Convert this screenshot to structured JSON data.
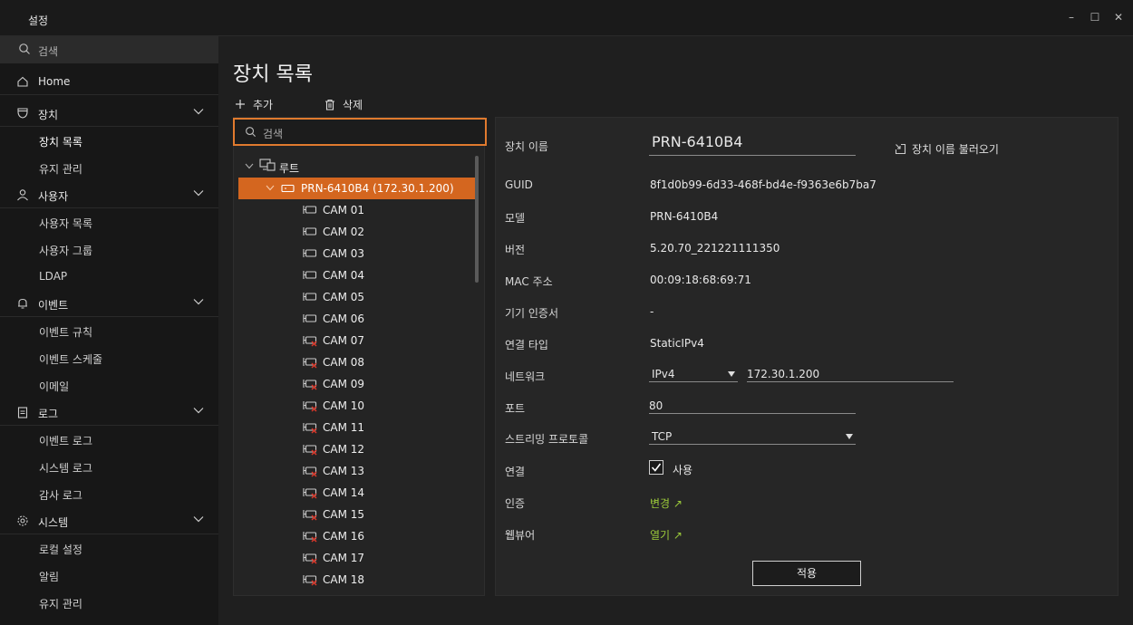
{
  "window": {
    "title": "설정"
  },
  "sidebar": {
    "search_placeholder": "검색",
    "home": "Home",
    "groups": [
      {
        "label": "장치",
        "items": [
          "장치 목록",
          "유지 관리"
        ]
      },
      {
        "label": "사용자",
        "items": [
          "사용자 목록",
          "사용자 그룹",
          "LDAP"
        ]
      },
      {
        "label": "이벤트",
        "items": [
          "이벤트 규칙",
          "이벤트 스케줄",
          "이메일"
        ]
      },
      {
        "label": "로그",
        "items": [
          "이벤트 로그",
          "시스템 로그",
          "감사 로그"
        ]
      },
      {
        "label": "시스템",
        "items": [
          "로컬 설정",
          "알림",
          "유지 관리"
        ]
      }
    ]
  },
  "main": {
    "title": "장치 목록",
    "add_label": "추가",
    "delete_label": "삭제"
  },
  "tree": {
    "search_placeholder": "검색",
    "root": "루트",
    "device": "PRN-6410B4 (172.30.1.200)",
    "cameras": [
      {
        "name": "CAM 01",
        "connected": true
      },
      {
        "name": "CAM 02",
        "connected": true
      },
      {
        "name": "CAM 03",
        "connected": true
      },
      {
        "name": "CAM 04",
        "connected": true
      },
      {
        "name": "CAM 05",
        "connected": true
      },
      {
        "name": "CAM 06",
        "connected": true
      },
      {
        "name": "CAM 07",
        "connected": false
      },
      {
        "name": "CAM 08",
        "connected": false
      },
      {
        "name": "CAM 09",
        "connected": false
      },
      {
        "name": "CAM 10",
        "connected": false
      },
      {
        "name": "CAM 11",
        "connected": false
      },
      {
        "name": "CAM 12",
        "connected": false
      },
      {
        "name": "CAM 13",
        "connected": false
      },
      {
        "name": "CAM 14",
        "connected": false
      },
      {
        "name": "CAM 15",
        "connected": false
      },
      {
        "name": "CAM 16",
        "connected": false
      },
      {
        "name": "CAM 17",
        "connected": false
      },
      {
        "name": "CAM 18",
        "connected": false
      }
    ]
  },
  "detail": {
    "name_label": "장치 이름",
    "name_value": "PRN-6410B4",
    "load_name": "장치 이름 불러오기",
    "guid_label": "GUID",
    "guid_value": "8f1d0b99-6d33-468f-bd4e-f9363e6b7ba7",
    "model_label": "모델",
    "model_value": "PRN-6410B4",
    "version_label": "버전",
    "version_value": "5.20.70_221221111350",
    "mac_label": "MAC 주소",
    "mac_value": "00:09:18:68:69:71",
    "cert_label": "기기 인증서",
    "cert_value": "-",
    "conn_type_label": "연결 타입",
    "conn_type_value": "StaticIPv4",
    "network_label": "네트워크",
    "network_proto": "IPv4",
    "network_ip": "172.30.1.200",
    "port_label": "포트",
    "port_value": "80",
    "stream_label": "스트리밍 프로토콜",
    "stream_value": "TCP",
    "connect_label": "연결",
    "connect_checkbox": "사용",
    "auth_label": "인증",
    "auth_link": "변경 ↗",
    "webviewer_label": "웹뷰어",
    "webviewer_link": "열기 ↗",
    "apply": "적용"
  },
  "colors": {
    "accent": "#d4661f",
    "link": "#9ccb3a",
    "focus": "#e07a2e",
    "disconnected": "#d9372a"
  }
}
